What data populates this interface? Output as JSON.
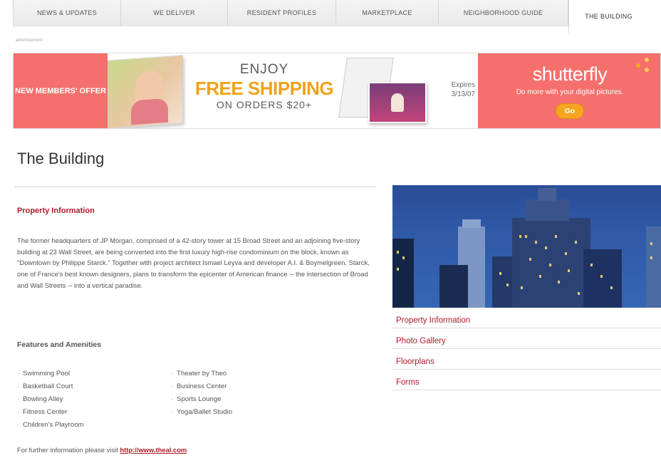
{
  "nav": {
    "tabs": [
      {
        "label": "NEWS & UPDATES"
      },
      {
        "label": "WE DELIVER"
      },
      {
        "label": "RESIDENT PROFILES"
      },
      {
        "label": "MARKETPLACE"
      },
      {
        "label": "NEIGHBORHOOD GUIDE"
      },
      {
        "label": "THE BUILDING",
        "active": true
      }
    ]
  },
  "ad_label": "advertisement",
  "banner": {
    "left_text": "NEW MEMBERS' OFFER",
    "enjoy": "ENJOY",
    "free_shipping": "FREE SHIPPING",
    "orders": "ON ORDERS $20+",
    "expires_label": "Expires",
    "expires_date": "3/13/07",
    "brand": "shutterfly",
    "tagline": "Do more with your digital pictures.",
    "go_button": "Go",
    "colors": {
      "coral": "#f5706c",
      "orange": "#f0a21b"
    }
  },
  "page": {
    "title": "The Building"
  },
  "main": {
    "section_title": "Property Information",
    "body": "The former headquarters of JP Morgan, comprised of a 42-story tower at 15 Broad Street and an adjoining five-story building at 23 Wall Street, are being converted into the first luxury high-rise condominium on the block, known as \"Downtown by Philippe Starck.\" Together with project architect Ismael Leyva and developer A.I. & Boymelgreen, Starck, one of France's best known designers, plans to transform the epicenter of American finance -- the intersection of Broad and Wall Streets -- into a vertical paradise.",
    "features_title": "Features and Amenities",
    "amenities_col1": [
      "Swimming Pool",
      "Basketball Court",
      "Bowling Alley",
      "Fitness Center",
      "Children's Playroom"
    ],
    "amenities_col2": [
      "Theater by Theo",
      "Business Center",
      "Sports Lounge",
      "Yoga/Ballet Studio"
    ],
    "further_text": "For further information please visit",
    "further_link": "http://www.theal.com"
  },
  "sidebar": {
    "links": [
      {
        "label": "Property Information"
      },
      {
        "label": "Photo Gallery"
      },
      {
        "label": "Floorplans"
      },
      {
        "label": "Forms"
      }
    ]
  },
  "accent_color": "#b01a2a"
}
